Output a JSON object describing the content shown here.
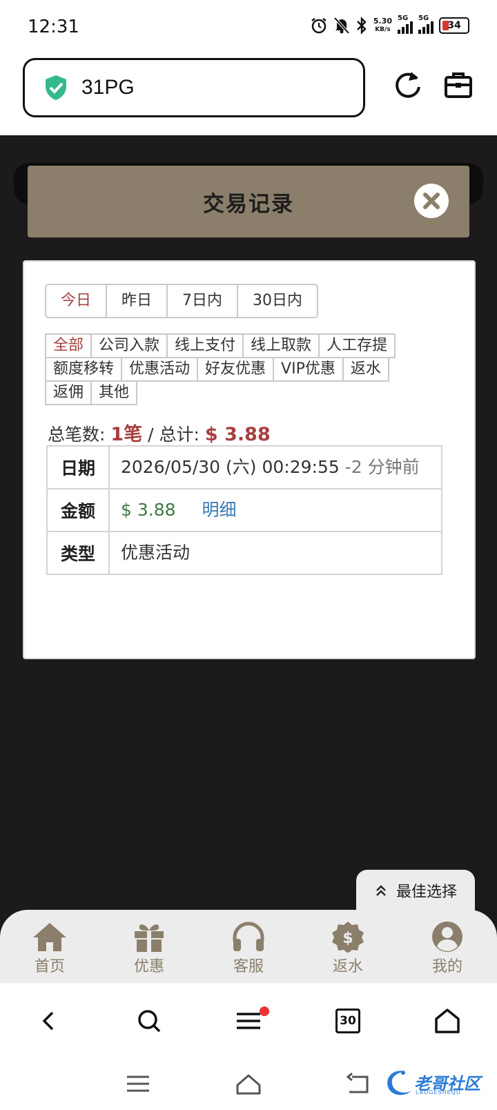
{
  "status_bar": {
    "time": "12:31",
    "net_speed_value": "5.30",
    "net_speed_unit": "KB/s",
    "signal1_label": "5G",
    "signal2_label": "5G",
    "battery": "34"
  },
  "address_bar": {
    "url": "31PG"
  },
  "modal": {
    "title": "交易记录",
    "day_tabs": [
      {
        "label": "今日",
        "active": true
      },
      {
        "label": "昨日",
        "active": false
      },
      {
        "label": "7日内",
        "active": false
      },
      {
        "label": "30日内",
        "active": false
      }
    ],
    "type_filters": [
      {
        "label": "全部",
        "active": true
      },
      {
        "label": "公司入款"
      },
      {
        "label": "线上支付"
      },
      {
        "label": "线上取款"
      },
      {
        "label": "人工存提"
      },
      {
        "label": "额度移转"
      },
      {
        "label": "优惠活动"
      },
      {
        "label": "好友优惠"
      },
      {
        "label": "VIP优惠"
      },
      {
        "label": "返水"
      },
      {
        "label": "返佣"
      },
      {
        "label": "其他"
      }
    ],
    "summary": {
      "count_label": "总笔数:",
      "count_value": "1笔",
      "separator": "/",
      "total_label": "总计:",
      "total_value": "$ 3.88"
    },
    "record": {
      "date_label": "日期",
      "date_value": "2026/05/30 (六) 00:29:55",
      "date_relative": "-2 分钟前",
      "amount_label": "金额",
      "amount_value": "$ 3.88",
      "detail_link": "明细",
      "type_label": "类型",
      "type_value": "优惠活动"
    }
  },
  "best_choice": {
    "label": "最佳选择"
  },
  "site_nav": [
    {
      "label": "首页",
      "icon": "home-icon"
    },
    {
      "label": "优惠",
      "icon": "gift-icon"
    },
    {
      "label": "客服",
      "icon": "headset-icon"
    },
    {
      "label": "返水",
      "icon": "dollar-badge-icon"
    },
    {
      "label": "我的",
      "icon": "user-icon"
    }
  ],
  "browser_bar": {
    "tab_count": "30"
  },
  "watermark": {
    "text": "老哥社区",
    "subtext": "LAOGESHEQU"
  }
}
